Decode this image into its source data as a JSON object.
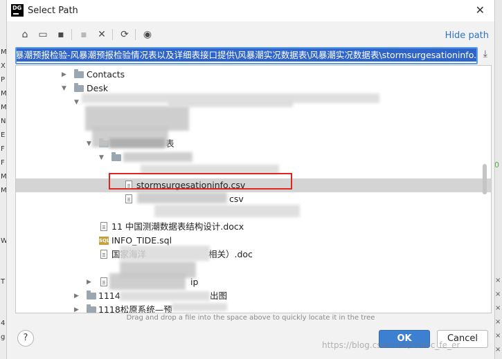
{
  "dialog": {
    "app_logo": "DG",
    "title": "Select Path",
    "close_icon": "close-icon"
  },
  "toolbar": {
    "hide_path_label": "Hide path",
    "buttons": [
      "home-icon",
      "desktop-icon",
      "project-icon",
      "new-folder-icon",
      "delete-icon",
      "refresh-icon",
      "show-hidden-icon"
    ]
  },
  "path": {
    "value": "暴潮预报检验-风暴潮预报检验情况表以及详细表接口提供\\风暴潮实况数据表\\风暴潮实况数据表\\stormsurgesationinfo.csv"
  },
  "tree": {
    "contacts": "Contacts",
    "desktop": "Desk",
    "folder_frag_1": "表",
    "selected_file": "stormsurgesationinfo.csv",
    "file_frag_csv": "csv",
    "docx_file": "11 中国测潮数据表结构设计.docx",
    "sql_file": "INFO_TIDE.sql",
    "doc_frag": "相关）.doc",
    "doc_prefix": "国家海洋",
    "zip_frag": "ip",
    "folder_1114": "1114",
    "folder_1114_suffix": "出图",
    "folder_1118": "1118松原系统—预"
  },
  "hint": "Drag and drop a file into the space above to quickly locate it in the tree",
  "buttons": {
    "ok": "OK",
    "cancel": "Cancel",
    "help": "?"
  },
  "watermark": "https://blog.csdn.net/ccnbc_fe_er",
  "background": {
    "left_chars": [
      "M",
      "X",
      "P",
      "M",
      "M",
      "N",
      "E",
      "F",
      "F",
      "M",
      "M",
      "W",
      "T",
      "4",
      "g"
    ],
    "right_ticks": [
      "×",
      "×",
      "×",
      "×",
      "×",
      "×"
    ]
  }
}
